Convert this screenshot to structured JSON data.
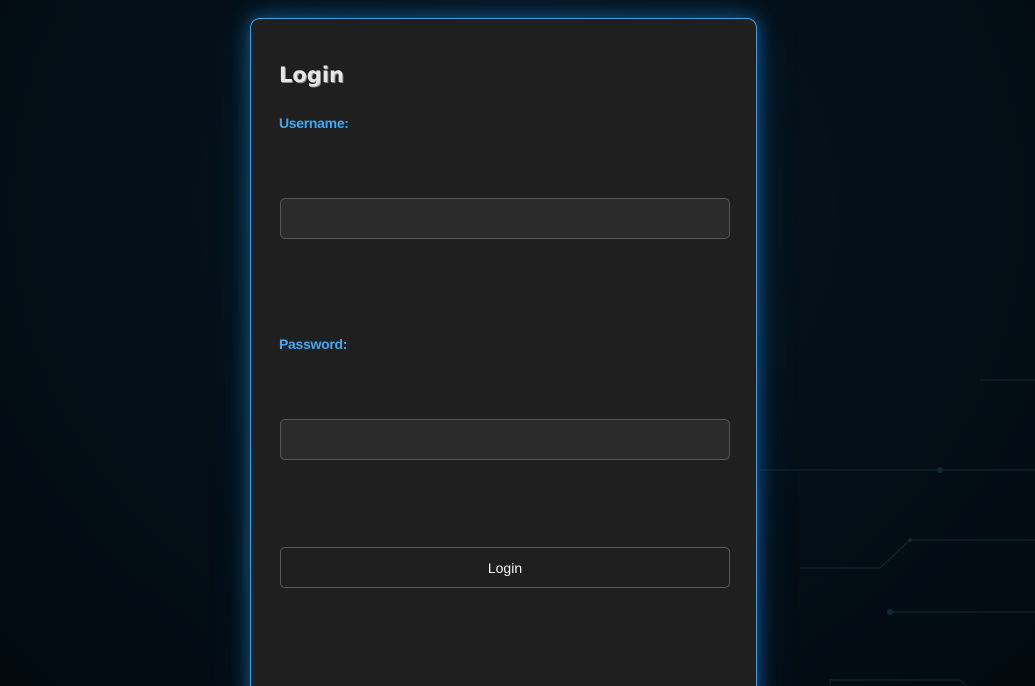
{
  "login_form": {
    "title": "Login",
    "username_label": "Username:",
    "username_value": "",
    "password_label": "Password:",
    "password_value": "",
    "submit_label": "Login"
  },
  "colors": {
    "background": "#020a10",
    "card_background": "#1f1f1f",
    "card_border": "#3aa0e0",
    "label_accent": "#3ea8f5",
    "input_background": "#2b2b2b"
  }
}
